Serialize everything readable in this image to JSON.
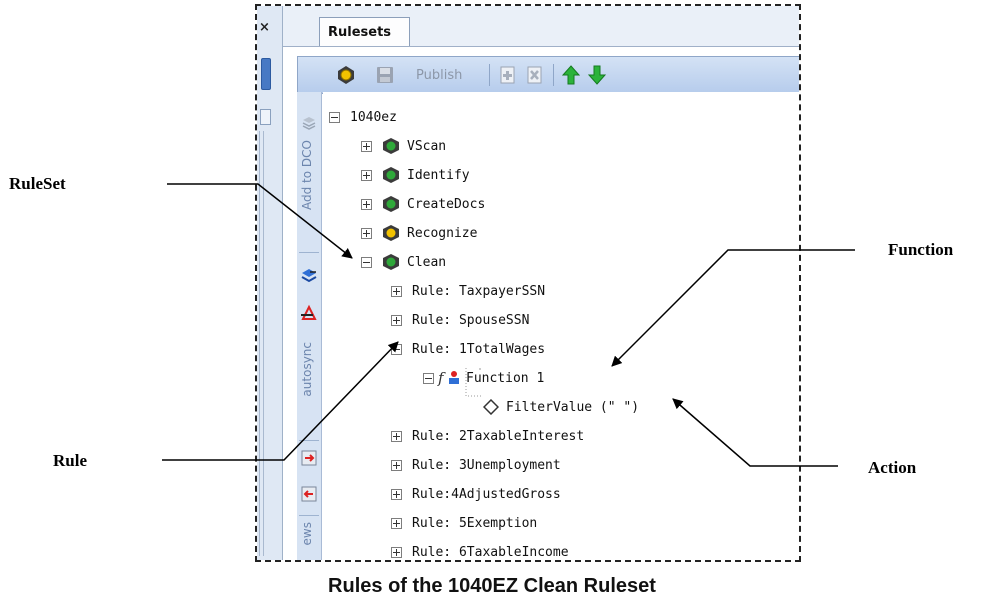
{
  "panel": {
    "tab_label": "Rulesets",
    "left_close_glyph": "×",
    "toolbar": {
      "publish_label": "Publish"
    },
    "side_strip": {
      "add_to_dco": "Add to DCO",
      "autosync": "autosync",
      "views": "ews"
    }
  },
  "tree": {
    "root": "1040ez",
    "rulesets": [
      {
        "label": "VScan",
        "light": "green"
      },
      {
        "label": "Identify",
        "light": "green"
      },
      {
        "label": "CreateDocs",
        "light": "green"
      },
      {
        "label": "Recognize",
        "light": "yellow"
      },
      {
        "label": "Clean",
        "light": "green"
      }
    ],
    "rules_before": [
      "Rule: TaxpayerSSN",
      "Rule: SpouseSSN"
    ],
    "expanded_rule": "Rule: 1TotalWages",
    "function_label": "Function 1",
    "action_label": "FilterValue (\" \")",
    "rules_after": [
      "Rule: 2TaxableInterest",
      "Rule: 3Unemployment",
      "Rule:4AdjustedGross",
      "Rule: 5Exemption",
      "Rule: 6TaxableIncome"
    ]
  },
  "annotations": {
    "ruleset": "RuleSet",
    "function": "Function",
    "rule": "Rule",
    "action": "Action"
  },
  "caption": "Rules of the 1040EZ Clean Ruleset",
  "colors": {
    "light_green": "#2fa83a",
    "light_yellow": "#f2c200",
    "arrow_up": "#2bb33a",
    "arrow_down": "#2bb33a"
  }
}
